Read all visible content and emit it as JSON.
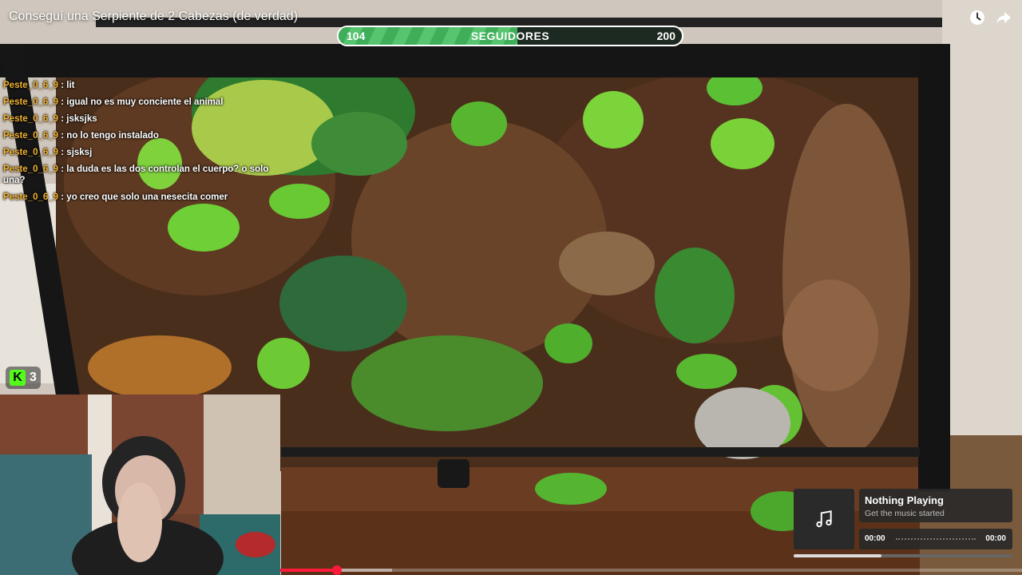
{
  "video": {
    "title": "Conseguí una Serpiente de 2 Cabezas (de verdad)",
    "played_fraction": 0.076
  },
  "icons": {
    "clock": "clock-icon",
    "share": "share-icon",
    "music": "music-note-icon"
  },
  "followers": {
    "current": "104",
    "label": "SEGUIDORES",
    "goal": "200",
    "fill_fraction": 0.52
  },
  "chat": [
    {
      "user": "Peste_0_6_9",
      "message": "lit"
    },
    {
      "user": "Peste_0_6_9",
      "message": "igual no es muy conciente el animal"
    },
    {
      "user": "Peste_0_6_9",
      "message": "jsksjks"
    },
    {
      "user": "Peste_0_6_9",
      "message": "no lo tengo instalado"
    },
    {
      "user": "Peste_0_6_9",
      "message": "sjsksj"
    },
    {
      "user": "Peste_0_6_9",
      "message": "la duda es las dos controlan el cuerpo? o solo una?"
    },
    {
      "user": "Peste_0_6_9",
      "message": "yo creo que solo una nesecita comer"
    }
  ],
  "kick": {
    "logo": "K",
    "viewers": "3"
  },
  "now_playing": {
    "title": "Nothing Playing",
    "subtitle": "Get the music started",
    "time_current": "00:00",
    "time_total": "00:00",
    "progress_fraction": 0.4
  },
  "colors": {
    "chat_user": "#f2b232",
    "followers_fill": "#3fae5a",
    "kick_brand": "#53fc18",
    "video_progress": "#ff1a3c"
  }
}
